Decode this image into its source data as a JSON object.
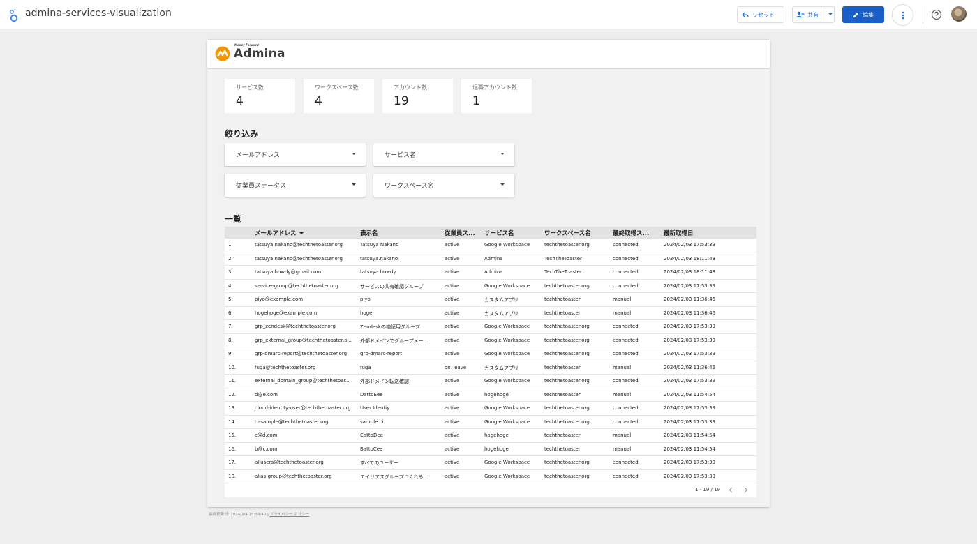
{
  "app": {
    "title": "admina-services-visualization",
    "reset_label": "リセット",
    "share_label": "共有",
    "edit_label": "編集"
  },
  "brand": {
    "sub": "Money Forward",
    "name": "Admina"
  },
  "scorecards": [
    {
      "label": "サービス数",
      "value": "4"
    },
    {
      "label": "ワークスペース数",
      "value": "4"
    },
    {
      "label": "アカウント数",
      "value": "19"
    },
    {
      "label": "退職アカウント数",
      "value": "1"
    }
  ],
  "filters": {
    "title": "絞り込み",
    "items": [
      "メールアドレス",
      "サービス名",
      "従業員ステータス",
      "ワークスペース名"
    ]
  },
  "table": {
    "title": "一覧",
    "headers": [
      "メールアドレス",
      "表示名",
      "従業員ス...",
      "サービス名",
      "ワークスペース名",
      "最終取得ス...",
      "最新取得日"
    ],
    "rows": [
      [
        "1.",
        "tatsuya.nakano@techthetoaster.org",
        "Tatsuya Nakano",
        "active",
        "Google Workspace",
        "techthetoaster.org",
        "connected",
        "2024/02/03 17:53:39"
      ],
      [
        "2.",
        "tatsuya.nakano@techthetoaster.org",
        "tatsuya.nakano",
        "active",
        "Admina",
        "TechTheToaster",
        "connected",
        "2024/02/03 18:11:43"
      ],
      [
        "3.",
        "tatsuya.howdy@gmail.com",
        "tatsuya.howdy",
        "active",
        "Admina",
        "TechTheToaster",
        "connected",
        "2024/02/03 18:11:43"
      ],
      [
        "4.",
        "service-group@techthetoaster.org",
        "サービスの共有確認グループ",
        "active",
        "Google Workspace",
        "techthetoaster.org",
        "connected",
        "2024/02/03 17:53:39"
      ],
      [
        "5.",
        "piyo@example.com",
        "piyo",
        "active",
        "カスタムアプリ",
        "techthetoaster",
        "manual",
        "2024/02/03 11:36:46"
      ],
      [
        "6.",
        "hogehoge@example.com",
        "hoge",
        "active",
        "カスタムアプリ",
        "techthetoaster",
        "manual",
        "2024/02/03 11:36:46"
      ],
      [
        "7.",
        "grp_zendesk@techthetoaster.org",
        "Zendeskの検証用グループ",
        "active",
        "Google Workspace",
        "techthetoaster.org",
        "connected",
        "2024/02/03 17:53:39"
      ],
      [
        "8.",
        "grp_external_group@techthetoaster.o...",
        "外部ドメインでグループメー...",
        "active",
        "Google Workspace",
        "techthetoaster.org",
        "connected",
        "2024/02/03 17:53:39"
      ],
      [
        "9.",
        "grp-dmarc-report@techthetoaster.org",
        "grp-dmarc-report",
        "active",
        "Google Workspace",
        "techthetoaster.org",
        "connected",
        "2024/02/03 17:53:39"
      ],
      [
        "10.",
        "fuga@techthetoaster.org",
        "fuga",
        "on_leave",
        "カスタムアプリ",
        "techthetoaster",
        "manual",
        "2024/02/03 11:36:46"
      ],
      [
        "11.",
        "external_domain_group@techthetoas...",
        "外部ドメイン転送確認",
        "active",
        "Google Workspace",
        "techthetoaster.org",
        "connected",
        "2024/02/03 17:53:39"
      ],
      [
        "12.",
        "d@e.com",
        "DattoEee",
        "active",
        "hogehoge",
        "techthetoaster",
        "manual",
        "2024/02/03 11:54:54"
      ],
      [
        "13.",
        "cloud-identity-user@techthetoaster.org",
        "User Identiy",
        "active",
        "Google Workspace",
        "techthetoaster.org",
        "connected",
        "2024/02/03 17:53:39"
      ],
      [
        "14.",
        "ci-sample@techthetoaster.org",
        "sample ci",
        "active",
        "Google Workspace",
        "techthetoaster.org",
        "connected",
        "2024/02/03 17:53:39"
      ],
      [
        "15.",
        "c@d.com",
        "CattoDee",
        "active",
        "hogehoge",
        "techthetoaster",
        "manual",
        "2024/02/03 11:54:54"
      ],
      [
        "16.",
        "b@c.com",
        "BattoCee",
        "active",
        "hogehoge",
        "techthetoaster",
        "manual",
        "2024/02/03 11:54:54"
      ],
      [
        "17.",
        "allusers@techthetoaster.org",
        "すべてのユーザー",
        "active",
        "Google Workspace",
        "techthetoaster.org",
        "connected",
        "2024/02/03 17:53:39"
      ],
      [
        "18.",
        "alias-group@techthetoaster.org",
        "エイリアスグループつくれる...",
        "active",
        "Google Workspace",
        "techthetoaster.org",
        "connected",
        "2024/02/03 17:53:39"
      ]
    ],
    "pagination": "1 - 19 / 19"
  },
  "footer": {
    "updated": "最終更新日: 2024/2/4 15:38:40",
    "separator": "|",
    "privacy": "プライバシー ポリシー"
  },
  "colors": {
    "primary": "#1a5fc8",
    "link": "#1a73e8",
    "brand_orange": "#f39800"
  }
}
